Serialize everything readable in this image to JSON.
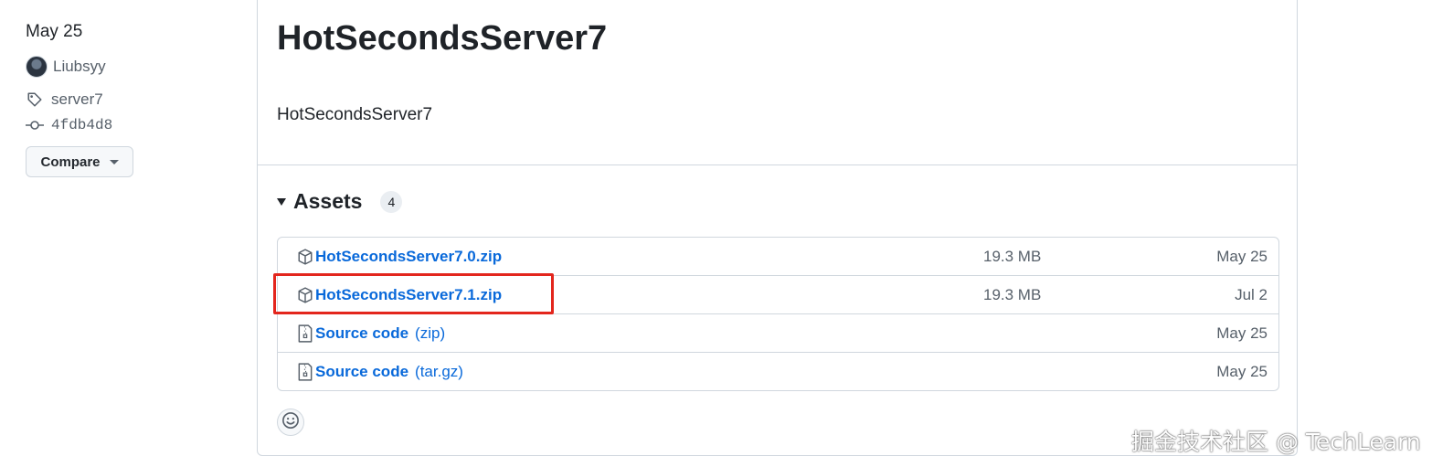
{
  "sidebar": {
    "date": "May 25",
    "author": "Liubsyy",
    "tag": "server7",
    "commit": "4fdb4d8",
    "compare_label": "Compare"
  },
  "release": {
    "title": "HotSecondsServer7",
    "body": "HotSecondsServer7"
  },
  "assets": {
    "heading": "Assets",
    "count": "4",
    "items": [
      {
        "icon": "package-icon",
        "name": "HotSecondsServer7.0.zip",
        "ext": "",
        "size": "19.3 MB",
        "date": "May 25"
      },
      {
        "icon": "package-icon",
        "name": "HotSecondsServer7.1.zip",
        "ext": "",
        "size": "19.3 MB",
        "date": "Jul 2"
      },
      {
        "icon": "file-zip-icon",
        "name": "Source code",
        "ext": "(zip)",
        "size": "",
        "date": "May 25"
      },
      {
        "icon": "file-zip-icon",
        "name": "Source code",
        "ext": "(tar.gz)",
        "size": "",
        "date": "May 25"
      }
    ]
  },
  "watermark": "掘金技术社区 @ TechLearn",
  "colors": {
    "link": "#0969da",
    "highlight": "#e3261d",
    "border": "#d0d7de"
  }
}
